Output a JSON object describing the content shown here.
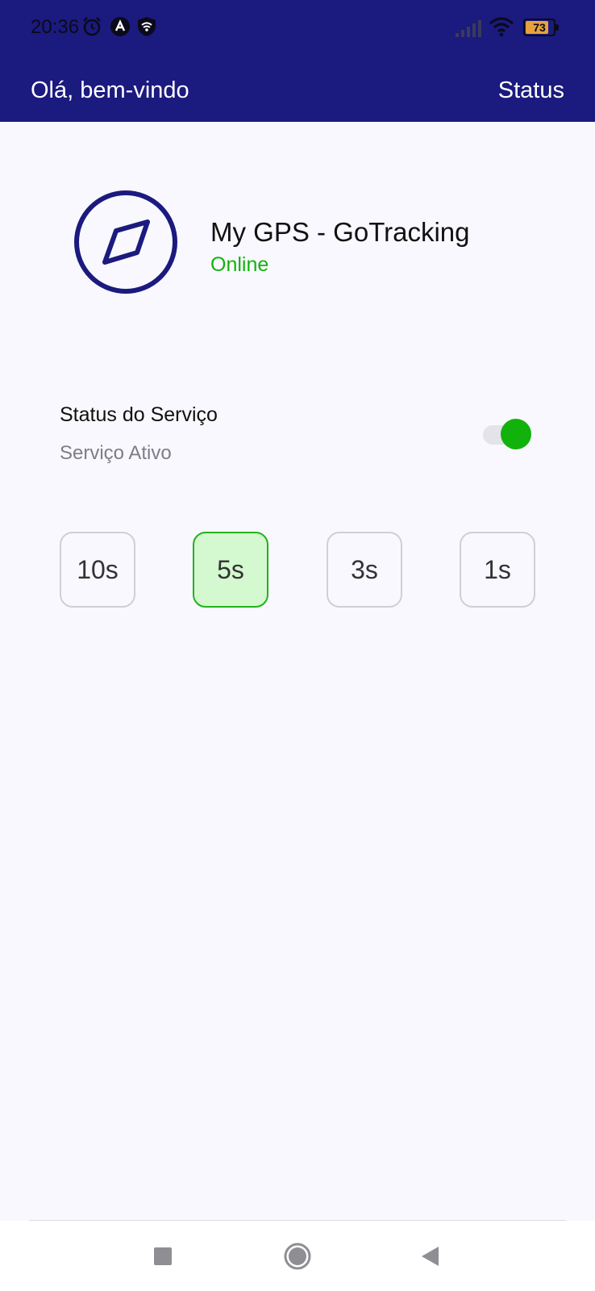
{
  "status_bar": {
    "time": "20:36",
    "battery_level": "73",
    "icons": [
      "alarm-icon",
      "app-notification-icon",
      "shield-wifi-icon",
      "signal-icon",
      "wifi-icon",
      "battery-icon"
    ]
  },
  "app_bar": {
    "title": "Olá, bem-vindo",
    "action_label": "Status",
    "background_color": "#1b1a7e"
  },
  "header": {
    "logo_icon": "compass-icon",
    "app_name": "My GPS - GoTracking",
    "state": "Online",
    "state_color": "#12b20c"
  },
  "service": {
    "title": "Status do Serviço",
    "subtitle": "Serviço Ativo",
    "enabled": true,
    "toggle_color": "#12b20c"
  },
  "intervals": {
    "options": [
      "10s",
      "5s",
      "3s",
      "1s"
    ],
    "selected": "5s"
  },
  "nav_bar": {
    "icons": [
      "recents-square-icon",
      "home-circle-icon",
      "back-triangle-icon"
    ]
  }
}
